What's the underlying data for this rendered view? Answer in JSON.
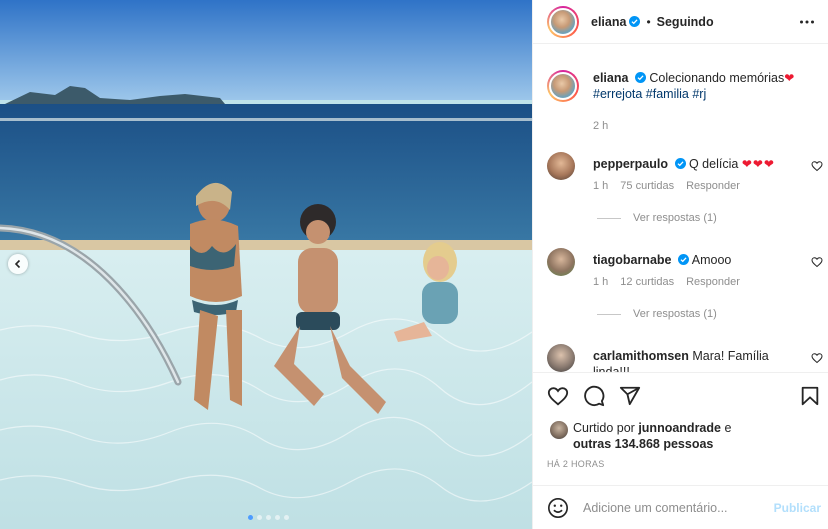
{
  "post": {
    "author": "eliana",
    "follow_status": "Seguindo",
    "separator": "•",
    "caption_text": "Colecionando memórias",
    "caption_emoji": "❤",
    "hashtags": "#errejota #familia #rj",
    "caption_time": "2 h"
  },
  "comments": [
    {
      "user": "pepperpaulo",
      "verified": true,
      "text": "Q delícia",
      "emoji": "❤❤❤",
      "time": "1 h",
      "likes": "75 curtidas",
      "reply_label": "Responder",
      "view_replies": "Ver respostas (1)"
    },
    {
      "user": "tiagobarnabe",
      "verified": true,
      "text": "Amooo",
      "emoji": "",
      "time": "1 h",
      "likes": "12 curtidas",
      "reply_label": "Responder",
      "view_replies": "Ver respostas (1)"
    },
    {
      "user": "carlamithomsen",
      "verified": false,
      "text": "Mara! Família linda!!!",
      "emoji": ""
    }
  ],
  "liked_by": {
    "prefix": "Curtido por",
    "user": "junnoandrade",
    "conjunction": "e",
    "others": "outras 134.868 pessoas"
  },
  "time_ago": "HÁ 2 HORAS",
  "add_comment": {
    "placeholder": "Adicione um comentário...",
    "publish_label": "Publicar"
  },
  "icons": {
    "like": "heart-icon",
    "comment": "comment-bubble-icon",
    "share": "paper-plane-icon",
    "save": "bookmark-icon",
    "emoji": "smiley-icon",
    "more": "ellipsis-icon",
    "verified": "verified-badge-icon",
    "prev": "chevron-left-icon"
  },
  "colors": {
    "verified_blue": "#0095f6",
    "heart_red": "#ed1a32",
    "hashtag": "#00376b",
    "publish_disabled": "#b2dffc",
    "muted": "#8e8e8e"
  }
}
